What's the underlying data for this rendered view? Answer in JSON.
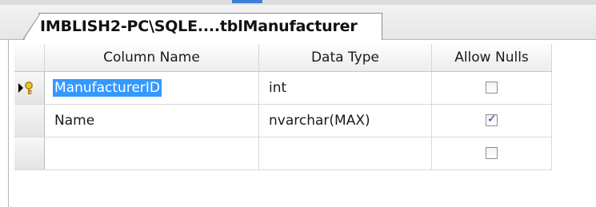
{
  "tab": {
    "title": "IMBLISH2-PC\\SQLE....tblManufacturer"
  },
  "grid": {
    "columns": [
      "Column Name",
      "Data Type",
      "Allow Nulls"
    ],
    "rows": [
      {
        "name": "ManufacturerID",
        "type": "int",
        "allow_nulls": false,
        "primary_key": true,
        "current": true
      },
      {
        "name": "Name",
        "type": "nvarchar(MAX)",
        "allow_nulls": true,
        "primary_key": false,
        "current": false
      },
      {
        "name": "",
        "type": "",
        "allow_nulls": false,
        "primary_key": false,
        "current": false
      }
    ]
  },
  "colors": {
    "selection": "#3399ff",
    "key_icon": "#d4a017",
    "check_mark": "#1c3f95"
  }
}
